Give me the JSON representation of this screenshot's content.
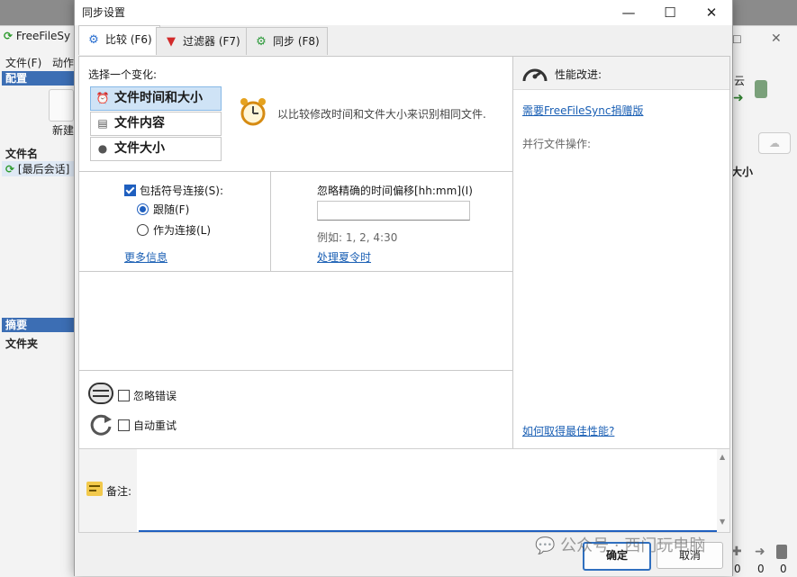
{
  "background_window": {
    "title": "FreeFileSy",
    "menu": [
      "文件(F)",
      "动作"
    ],
    "config_header": "配置",
    "new_label": "新建",
    "filename_header": "文件名",
    "last_session": "[最后会话]",
    "summary_header": "摘要",
    "folder_header": "文件夹",
    "right_col_header": "大小",
    "right_partial_label": "云",
    "counts": [
      "0",
      "0",
      "0"
    ]
  },
  "dialog": {
    "title": "同步设置",
    "controls": {
      "minimize": "—",
      "maximize": "☐",
      "close": "✕"
    },
    "tabs": [
      {
        "label": "比较 (F6)",
        "icon": "gear-icon",
        "active": true
      },
      {
        "label": "过滤器 (F7)",
        "icon": "filter-icon",
        "active": false
      },
      {
        "label": "同步 (F8)",
        "icon": "sync-gear-icon",
        "active": false
      }
    ],
    "compare": {
      "choose_label": "选择一个变化:",
      "variants": [
        {
          "label": "文件时间和大小",
          "selected": true
        },
        {
          "label": "文件内容",
          "selected": false
        },
        {
          "label": "文件大小",
          "selected": false
        }
      ],
      "description": "以比较修改时间和文件大小来识别相同文件.",
      "symlink": {
        "include_label": "包括符号连接(S):",
        "follow_label": "跟随(F)",
        "as_link_label": "作为连接(L)",
        "more_info": "更多信息"
      },
      "time_shift": {
        "label": "忽略精确的时间偏移[hh:mm](I)",
        "value": "",
        "example": "例如: 1, 2, 4:30",
        "dst_link": "处理夏令时"
      },
      "ignore_errors": "忽略错误",
      "auto_retry": "自动重试"
    },
    "performance": {
      "title": "性能改进:",
      "donation_link": "需要FreeFileSync捐赠版",
      "parallel_label": "并行文件操作:",
      "best_perf_link": "如何取得最佳性能?"
    },
    "notes": {
      "label": "备注:",
      "value": ""
    },
    "buttons": {
      "ok": "确定",
      "cancel": "取消"
    }
  },
  "watermark": "公众号 · 西门玩电脑",
  "colors": {
    "accent": "#1f5fbf",
    "selected_bg": "#cfe3f6",
    "header_blue": "#3c6eb4"
  }
}
